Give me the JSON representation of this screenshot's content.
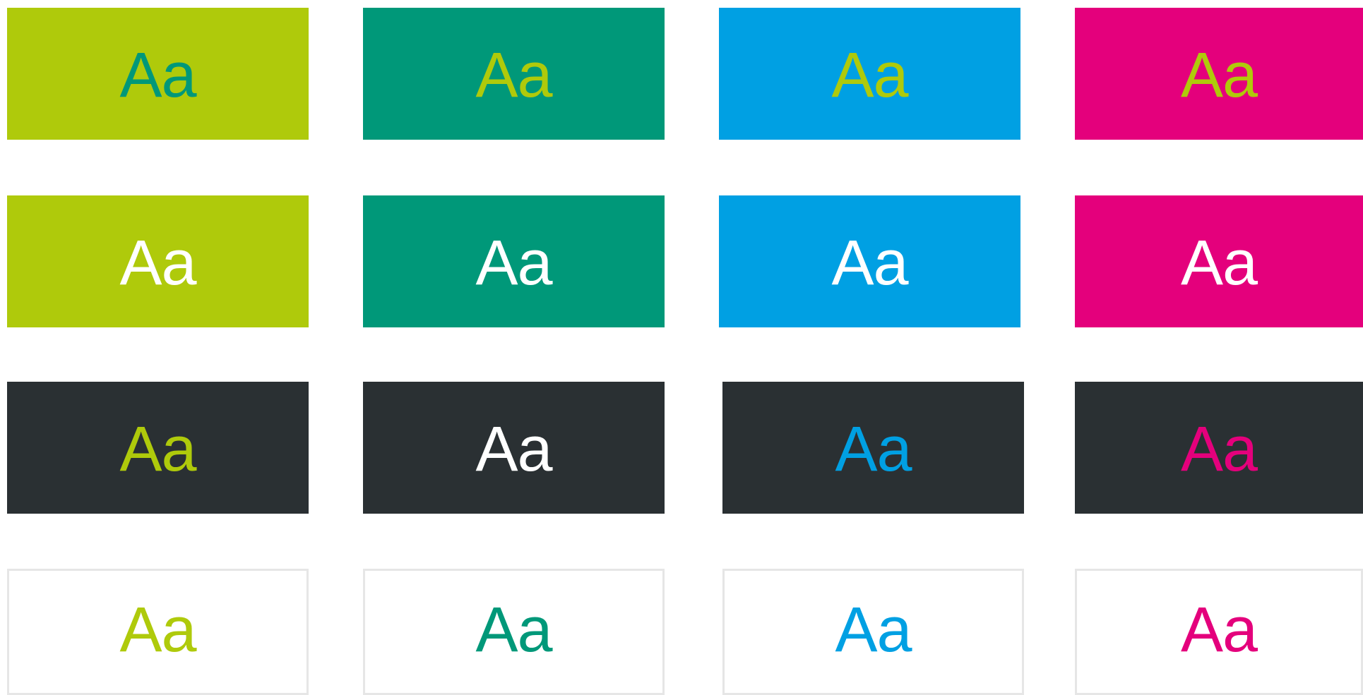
{
  "palette": {
    "lime": "#afca0b",
    "green": "#009879",
    "blue": "#00a0e3",
    "magenta": "#e4007c",
    "dark": "#2a3033",
    "white": "#ffffff",
    "outline": "#e6e6e6"
  },
  "rows": [
    {
      "cells": [
        {
          "text": "Aa",
          "bg": "#afca0b",
          "fg": "#009879"
        },
        {
          "text": "Aa",
          "bg": "#009879",
          "fg": "#afca0b"
        },
        {
          "text": "Aa",
          "bg": "#00a0e3",
          "fg": "#afca0b"
        },
        {
          "text": "Aa",
          "bg": "#e4007c",
          "fg": "#afca0b"
        }
      ]
    },
    {
      "cells": [
        {
          "text": "Aa",
          "bg": "#afca0b",
          "fg": "#ffffff"
        },
        {
          "text": "Aa",
          "bg": "#009879",
          "fg": "#ffffff"
        },
        {
          "text": "Aa",
          "bg": "#00a0e3",
          "fg": "#ffffff"
        },
        {
          "text": "Aa",
          "bg": "#e4007c",
          "fg": "#ffffff"
        }
      ]
    },
    {
      "cells": [
        {
          "text": "Aa",
          "bg": "#2a3033",
          "fg": "#afca0b"
        },
        {
          "text": "Aa",
          "bg": "#2a3033",
          "fg": "#ffffff"
        },
        {
          "text": "Aa",
          "bg": "#2a3033",
          "fg": "#00a0e3"
        },
        {
          "text": "Aa",
          "bg": "#2a3033",
          "fg": "#e4007c"
        }
      ]
    },
    {
      "cells": [
        {
          "text": "Aa",
          "bg": "#ffffff",
          "fg": "#afca0b"
        },
        {
          "text": "Aa",
          "bg": "#ffffff",
          "fg": "#009879"
        },
        {
          "text": "Aa",
          "bg": "#ffffff",
          "fg": "#00a0e3"
        },
        {
          "text": "Aa",
          "bg": "#ffffff",
          "fg": "#e4007c"
        }
      ]
    }
  ]
}
